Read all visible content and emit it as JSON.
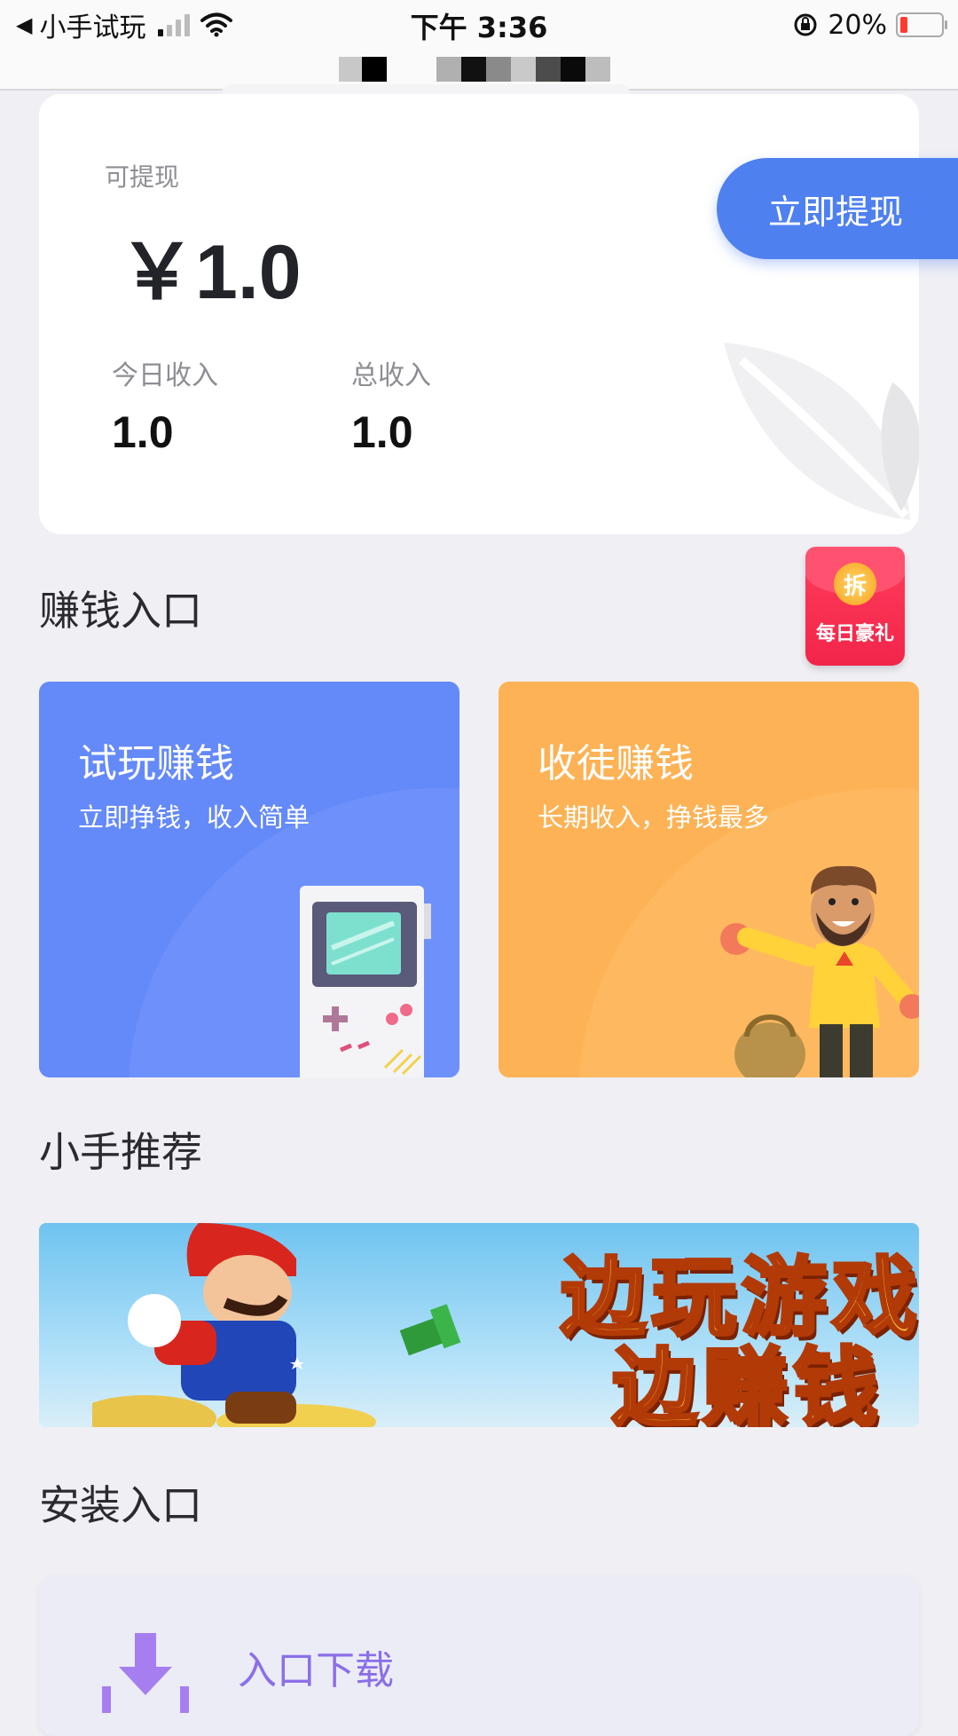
{
  "status_bar": {
    "back_app": "小手试玩",
    "time": "下午 3:36",
    "battery": "20%"
  },
  "wallet": {
    "withdrawable_label": "可提现",
    "withdrawable_amount": "￥1.0",
    "withdraw_button": "立即提现",
    "today_income_label": "今日收入",
    "today_income_value": "1.0",
    "total_income_label": "总收入",
    "total_income_value": "1.0"
  },
  "earn_section": {
    "title": "赚钱入口",
    "daily_gift": {
      "coin_label": "拆",
      "label": "每日豪礼"
    },
    "cards": [
      {
        "title": "试玩赚钱",
        "subtitle": "立即挣钱，收入简单"
      },
      {
        "title": "收徒赚钱",
        "subtitle": "长期收入，挣钱最多"
      }
    ]
  },
  "recommend_section": {
    "title": "小手推荐",
    "banner_line1": "边玩游戏",
    "banner_line2": "边赚钱"
  },
  "install_section": {
    "title": "安装入口",
    "card_label": "入口下载"
  },
  "colors": {
    "accent_blue": "#4f80f0",
    "card_blue": "#6489f9",
    "card_orange": "#fdb255",
    "gift_red": "#f2254a",
    "install_purple": "#8a6fe8"
  }
}
